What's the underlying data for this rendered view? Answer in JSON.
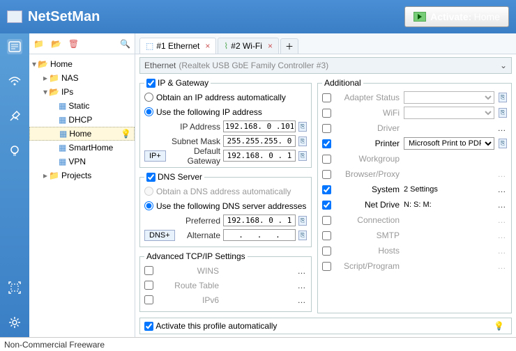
{
  "app_title": "NetSetMan",
  "activate": {
    "label": "Activate:",
    "profile": "Home"
  },
  "tree": {
    "root": "Home",
    "nas": "NAS",
    "ips": "IPs",
    "static": "Static",
    "dhcp": "DHCP",
    "home": "Home",
    "smarthome": "SmartHome",
    "vpn": "VPN",
    "projects": "Projects"
  },
  "tabs": {
    "t1": "#1 Ethernet",
    "t2": "#2 Wi-Fi"
  },
  "nic": {
    "label": "Ethernet",
    "detail": "(Realtek USB GbE Family Controller #3)"
  },
  "ipgw": {
    "legend": "IP & Gateway",
    "auto": "Obtain an IP address automatically",
    "manual": "Use the following IP address",
    "ip_lbl": "IP Address",
    "ip": "192.168. 0 .101",
    "mask_lbl": "Subnet Mask",
    "mask": "255.255.255. 0",
    "gw_lbl": "Default Gateway",
    "gw": "192.168. 0 . 1",
    "ipplus": "IP+"
  },
  "dns": {
    "legend": "DNS Server",
    "auto": "Obtain a DNS address automatically",
    "manual": "Use the following DNS server addresses",
    "pref_lbl": "Preferred",
    "pref": "192.168. 0 . 1",
    "alt_lbl": "Alternate",
    "alt": "  .   .   .  ",
    "dnsplus": "DNS+"
  },
  "adv": {
    "legend": "Advanced TCP/IP Settings",
    "wins": "WINS",
    "route": "Route Table",
    "ipv6": "IPv6"
  },
  "addl": {
    "legend": "Additional",
    "adapter": "Adapter Status",
    "wifi": "WiFi",
    "driver": "Driver",
    "printer": "Printer",
    "printer_val": "Microsoft Print to PDF",
    "workgroup": "Workgroup",
    "proxy": "Browser/Proxy",
    "system": "System",
    "system_val": "2 Settings",
    "netdrive": "Net Drive",
    "netdrive_val": "N: S: M:",
    "connection": "Connection",
    "smtp": "SMTP",
    "hosts": "Hosts",
    "script": "Script/Program"
  },
  "activate_auto": "Activate this profile automatically",
  "status": "Non-Commercial Freeware"
}
